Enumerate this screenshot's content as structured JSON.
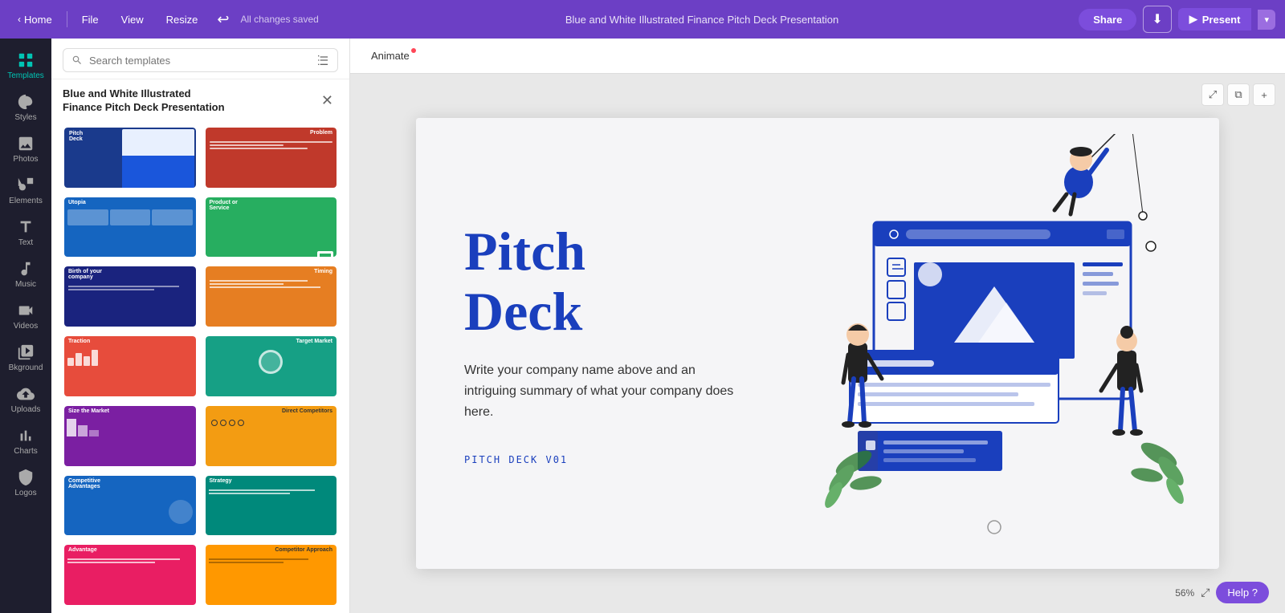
{
  "topbar": {
    "home_label": "Home",
    "file_label": "File",
    "view_label": "View",
    "resize_label": "Resize",
    "saved_text": "All changes saved",
    "title": "Blue and White Illustrated Finance Pitch Deck Presentation",
    "share_label": "Share",
    "download_label": "⬇",
    "present_label": "Present",
    "present_arrow": "▾"
  },
  "sidebar": {
    "items": [
      {
        "id": "templates",
        "label": "Templates",
        "icon": "grid"
      },
      {
        "id": "styles",
        "label": "Styles",
        "icon": "palette"
      },
      {
        "id": "photos",
        "label": "Photos",
        "icon": "image"
      },
      {
        "id": "elements",
        "label": "Elements",
        "icon": "shapes"
      },
      {
        "id": "text",
        "label": "Text",
        "icon": "text"
      },
      {
        "id": "music",
        "label": "Music",
        "icon": "music"
      },
      {
        "id": "videos",
        "label": "Videos",
        "icon": "video"
      },
      {
        "id": "background",
        "label": "Bkground",
        "icon": "background"
      },
      {
        "id": "uploads",
        "label": "Uploads",
        "icon": "upload"
      },
      {
        "id": "charts",
        "label": "Charts",
        "icon": "chart"
      },
      {
        "id": "logos",
        "label": "Logos",
        "icon": "logo"
      }
    ]
  },
  "templates_panel": {
    "search_placeholder": "Search templates",
    "title_line1": "Blue and White Illustrated",
    "title_line2": "Finance Pitch Deck Presentation",
    "close_icon": "✕",
    "thumbnails": [
      {
        "id": 1,
        "style": "blue",
        "title": "Pitch Deck"
      },
      {
        "id": 2,
        "style": "red",
        "title": "Problem"
      },
      {
        "id": 3,
        "style": "blue-light",
        "title": "Utopia"
      },
      {
        "id": 4,
        "style": "green",
        "title": "Product or Service"
      },
      {
        "id": 5,
        "style": "blue-dark",
        "title": "Birth of your company"
      },
      {
        "id": 6,
        "style": "orange",
        "title": "Timing"
      },
      {
        "id": 7,
        "style": "red2",
        "title": "Traction"
      },
      {
        "id": 8,
        "style": "teal",
        "title": "Target Market"
      },
      {
        "id": 9,
        "style": "purple",
        "title": "Size the Market"
      },
      {
        "id": 10,
        "style": "orange2",
        "title": "Direct Competitors"
      },
      {
        "id": 11,
        "style": "blue2",
        "title": "Competitive Advantages"
      },
      {
        "id": 12,
        "style": "teal2",
        "title": "Strategy"
      },
      {
        "id": 13,
        "style": "pink",
        "title": "Advantage"
      },
      {
        "id": 14,
        "style": "orange3",
        "title": "Competitor Approach"
      }
    ]
  },
  "canvas": {
    "animate_label": "Animate",
    "slide": {
      "pitch_title_line1": "Pitch",
      "pitch_title_line2": "Deck",
      "subtitle": "Write your company name above and an intriguing summary of what your company does here.",
      "code_label": "PITCH DECK V01"
    },
    "zoom_level": "56%",
    "expand_icon": "⤢",
    "help_label": "Help ?",
    "add_icon": "+"
  }
}
